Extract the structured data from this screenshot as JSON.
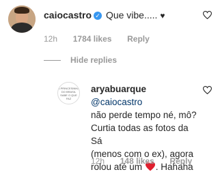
{
  "comment": {
    "username": "caiocastro",
    "verified_glyph": "✓",
    "text": "Que vibe..... ",
    "heart_glyph": "♥",
    "time": "12h",
    "likes": "1784 likes",
    "reply": "Reply"
  },
  "hide_replies": "Hide replies",
  "reply_comment": {
    "username": "aryabuarque",
    "mention": "@caiocastro",
    "text_line1": "não perde tempo né, mô?",
    "text_line2": "Curtia todas as fotos da Sá",
    "text_line3": "(menos com o ex), agora",
    "text_line4_a": "rolou até um ",
    "text_line4_b": ". Hahaha",
    "time": "12h",
    "likes": "148 likes",
    "reply": "Reply",
    "avatar_text": "A PRINCESINHA DO BRASIL SABE O QUE FAZ"
  },
  "colors": {
    "heart_red": "#ed4956",
    "verified_blue": "#3897f0",
    "muted": "#999999"
  },
  "icons": [
    "heart-outline-icon",
    "verified-badge-icon",
    "red-heart-emoji-icon"
  ]
}
